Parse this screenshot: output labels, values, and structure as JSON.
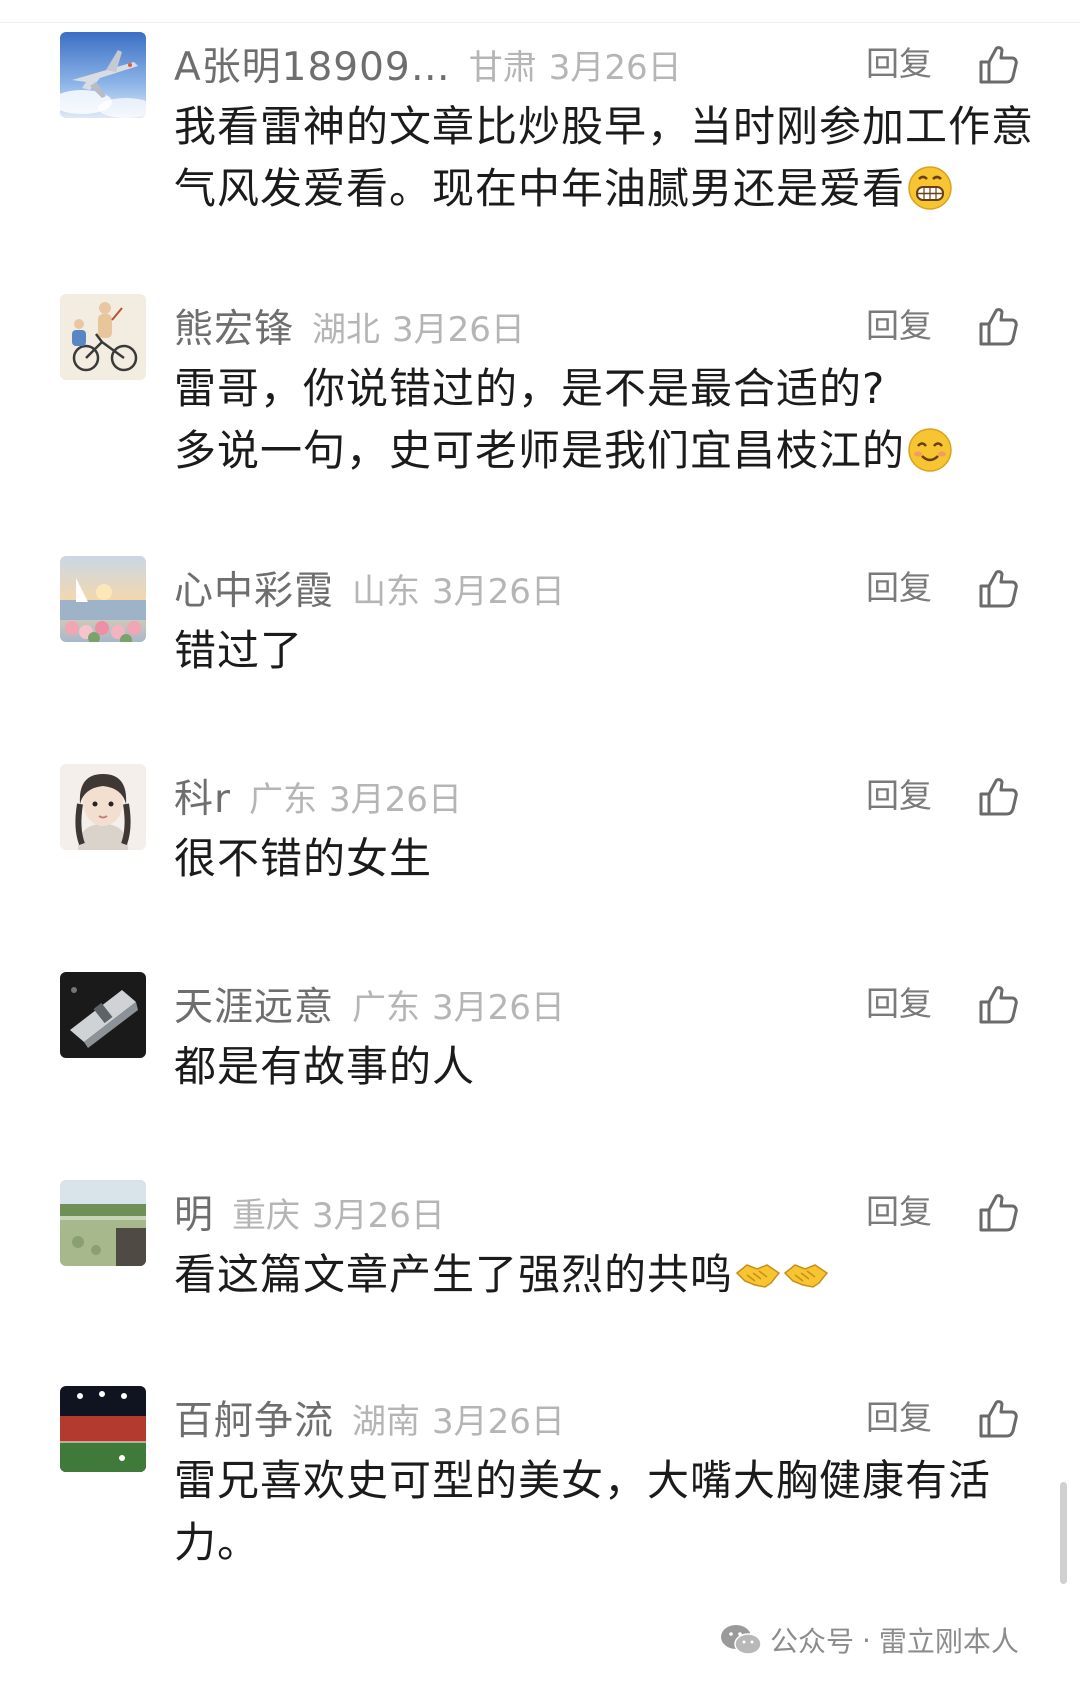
{
  "reply_label": "回复",
  "comments": [
    {
      "nickname": "A张明18909…",
      "region": "甘肃",
      "date": "3月26日",
      "text": "我看雷神的文章比炒股早，当时刚参加工作意气风发爱看。现在中年油腻男还是爱看",
      "emoji": [
        "grin-emoji"
      ]
    },
    {
      "nickname": "熊宏锋",
      "region": "湖北",
      "date": "3月26日",
      "text_lines": [
        "雷哥，你说错过的，是不是最合适的?",
        "多说一句，史可老师是我们宜昌枝江的"
      ],
      "emoji": [
        "smile-emoji"
      ]
    },
    {
      "nickname": "心中彩霞",
      "region": "山东",
      "date": "3月26日",
      "text": "错过了"
    },
    {
      "nickname": "科r",
      "region": "广东",
      "date": "3月26日",
      "text": "很不错的女生"
    },
    {
      "nickname": "天涯远意",
      "region": "广东",
      "date": "3月26日",
      "text": "都是有故事的人"
    },
    {
      "nickname": "明",
      "region": "重庆",
      "date": "3月26日",
      "text": "看这篇文章产生了强烈的共鸣",
      "emoji": [
        "handshake-emoji",
        "handshake-emoji"
      ]
    },
    {
      "nickname": "百舸争流",
      "region": "湖南",
      "date": "3月26日",
      "text": "雷兄喜欢史可型的美女，大嘴大胸健康有活力。"
    }
  ],
  "watermark": {
    "prefix": "公众号",
    "separator": "·",
    "account": "雷立刚本人"
  },
  "colors": {
    "nickname": "#6e6e6e",
    "meta": "#b5b5b5",
    "body_text": "#1b1b1b",
    "emoji_yellow": "#f7c531"
  }
}
